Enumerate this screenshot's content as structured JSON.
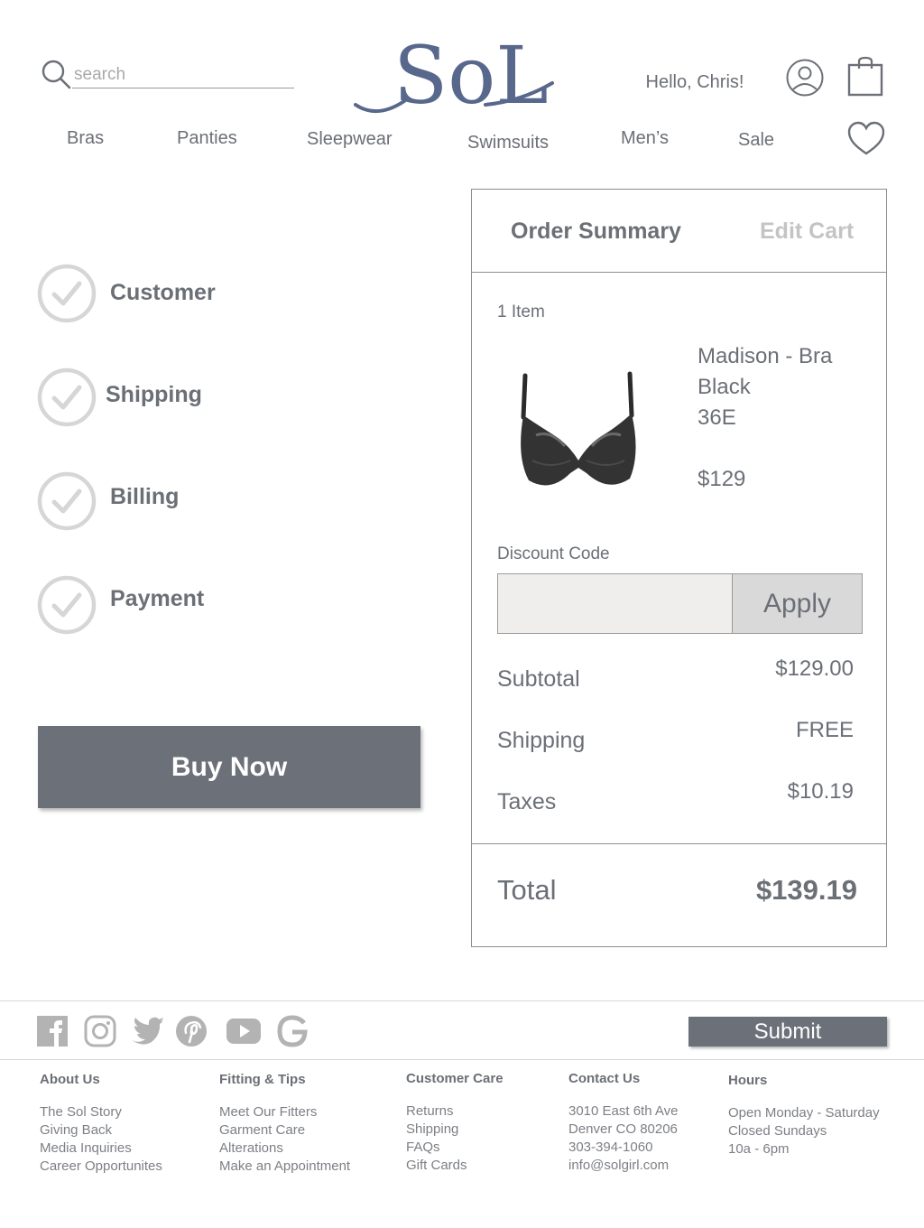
{
  "header": {
    "search_placeholder": "search",
    "logo_text": "SoL",
    "greeting": "Hello, Chris!"
  },
  "nav": {
    "items": [
      "Bras",
      "Panties",
      "Sleepwear",
      "Swimsuits",
      "Men’s",
      "Sale"
    ]
  },
  "checkout": {
    "steps": [
      {
        "label": "Customer",
        "status": "complete"
      },
      {
        "label": "Shipping",
        "status": "complete"
      },
      {
        "label": "Billing",
        "status": "complete"
      },
      {
        "label": "Payment",
        "status": "complete"
      }
    ],
    "buy_label": "Buy Now"
  },
  "summary": {
    "title": "Order Summary",
    "edit_cart": "Edit Cart",
    "item_count": "1 Item",
    "product": {
      "name": "Madison -  Bra",
      "color": "Black",
      "size": "36E",
      "price": "$129"
    },
    "discount": {
      "label": "Discount Code",
      "value": "",
      "apply_label": "Apply"
    },
    "rows": [
      {
        "label": "Subtotal",
        "value": "$129.00"
      },
      {
        "label": "Shipping",
        "value": "FREE"
      },
      {
        "label": "Taxes",
        "value": "$10.19"
      }
    ],
    "total_label": "Total",
    "total_value": "$139.19"
  },
  "footer": {
    "social": [
      "facebook-icon",
      "instagram-icon",
      "twitter-icon",
      "pinterest-icon",
      "youtube-icon",
      "google-icon"
    ],
    "submit_label": "Submit",
    "columns": [
      {
        "heading": "About Us",
        "links": [
          "The Sol Story",
          "Giving Back",
          "Media Inquiries",
          "Career Opportunites"
        ]
      },
      {
        "heading": "Fitting & Tips",
        "links": [
          "Meet Our Fitters",
          "Garment Care",
          "Alterations",
          "Make an Appointment"
        ]
      },
      {
        "heading": "Customer Care",
        "links": [
          "Returns",
          "Shipping",
          "FAQs",
          "Gift Cards"
        ]
      },
      {
        "heading": "Contact Us",
        "links": [
          "3010 East 6th Ave",
          "Denver CO 80206",
          "303-394-1060",
          "info@solgirl.com"
        ]
      },
      {
        "heading": "Hours",
        "links": [
          "Open Monday - Saturday",
          "Closed Sundays",
          "10a - 6pm"
        ]
      }
    ]
  },
  "colors": {
    "text": "#6b6f76",
    "button": "#6b7079",
    "logo": "#58688c",
    "check_circle": "#d6d6d6",
    "muted": "#c4c4c4"
  }
}
